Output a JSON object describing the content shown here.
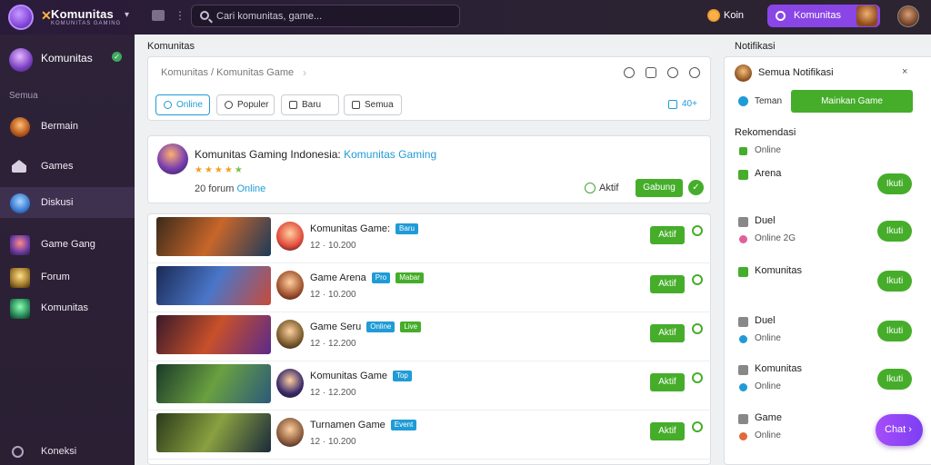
{
  "topbar": {
    "brand": "Komunitas",
    "brand_sub": "KOMUNITAS GAMING",
    "search_placeholder": "Cari komunitas, game...",
    "coins": "Koin",
    "purple_button_label": "Komunitas",
    "colors": {
      "bar": "#2a1b3a",
      "accent": "#8a45e6"
    }
  },
  "sidebar": {
    "user": "Komunitas",
    "section_label": "Semua",
    "items": [
      {
        "label": "Bermain",
        "icon": "game-icon"
      },
      {
        "label": "Games",
        "icon": "home-icon"
      },
      {
        "label": "Diskusi",
        "icon": "discussion-icon",
        "active": true
      },
      {
        "label": "Game Gang",
        "icon": "hero-icon"
      },
      {
        "label": "Forum",
        "icon": "forum-icon"
      },
      {
        "label": "Komunitas",
        "icon": "community-icon"
      }
    ],
    "bottom_label": "Koneksi"
  },
  "main": {
    "title": "Komunitas",
    "breadcrumb": "Komunitas / Komunitas Game",
    "filters": [
      "Online",
      "Populer",
      "Baru",
      "Semua"
    ],
    "count_label": "40+",
    "group": {
      "title": "Komunitas Gaming Indonesia: ",
      "title_link": "Komunitas Gaming",
      "stars": "★★★★",
      "star_extra": "★",
      "stat": "20 forum",
      "stat_link": "Online",
      "status_label": "Aktif",
      "join_button": "Gabung",
      "check": "✓"
    },
    "rows": [
      {
        "title": "Komunitas Game:",
        "tag1": "Baru",
        "tag2": "",
        "meta": "12 · 10.200",
        "button": "Aktif",
        "thumb_colors": [
          "#3a2a1a",
          "#c8662a",
          "#1c3a5a"
        ],
        "av_color": "#e04a3a"
      },
      {
        "title": "Game Arena",
        "tag1": "Pro",
        "tag2": "Mabar",
        "meta": "12 · 10.200",
        "button": "Aktif",
        "thumb_colors": [
          "#1a2a55",
          "#4a76c8",
          "#c84a3a"
        ],
        "av_color": "#a0502a"
      },
      {
        "title": "Game Seru",
        "tag1": "Online",
        "tag2": "Live",
        "meta": "12 · 12.200",
        "button": "Aktif",
        "thumb_colors": [
          "#3a1a2a",
          "#c8502a",
          "#5a2a8a"
        ],
        "av_color": "#7a5a2a"
      },
      {
        "title": "Komunitas Game",
        "tag1": "Top",
        "tag2": "",
        "meta": "12 · 12.200",
        "button": "Aktif",
        "thumb_colors": [
          "#1a3a2a",
          "#6aa040",
          "#2a5a7a"
        ],
        "av_color": "#3a2a6a"
      },
      {
        "title": "Turnamen Game",
        "tag1": "Event",
        "tag2": "",
        "meta": "12 · 10.200",
        "button": "Aktif",
        "thumb_colors": [
          "#2a3a1a",
          "#8aa040",
          "#1a2a3a"
        ],
        "av_color": "#8a5a3a"
      }
    ]
  },
  "right": {
    "title": "Notifikasi",
    "notif_title": "Semua Notifikasi",
    "notif_close": "×",
    "notif_sub": "Teman",
    "notif_button": "Mainkan Game",
    "section_title": "Rekomendasi",
    "first_sub": "Online",
    "contacts": [
      {
        "name": "Arena",
        "sub": "",
        "button": "Ikuti",
        "icon_color": "#45ad2a",
        "sub_color": "#1f9bd6"
      },
      {
        "name": "Duel",
        "sub": "Online 2G",
        "button": "Ikuti",
        "icon_color": "#888",
        "sub_color": "#e0609a"
      },
      {
        "name": "Komunitas",
        "sub": "",
        "button": "Ikuti",
        "icon_color": "#45ad2a",
        "sub_color": "#1f9bd6"
      },
      {
        "name": "Duel",
        "sub": "Online",
        "button": "Ikuti",
        "icon_color": "#888",
        "sub_color": "#1f9bd6"
      },
      {
        "name": "Komunitas",
        "sub": "Online",
        "button": "Ikuti",
        "icon_color": "#888",
        "sub_color": "#1f9bd6"
      },
      {
        "name": "Game",
        "sub": "Online",
        "button": "Ikuti",
        "icon_color": "#888",
        "sub_color": "#e06a3a"
      }
    ],
    "fab_label": "Chat ›"
  }
}
